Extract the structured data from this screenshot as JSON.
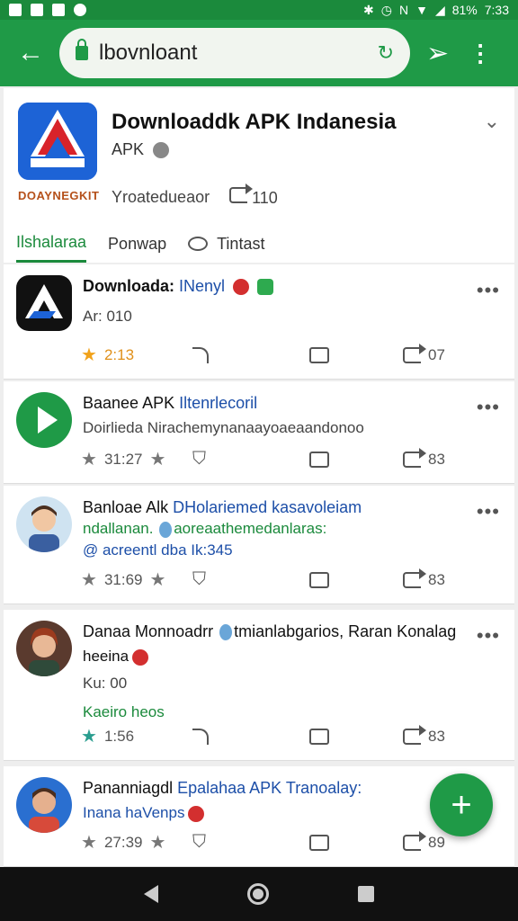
{
  "status": {
    "battery": "81%",
    "time": "7:33"
  },
  "browser": {
    "url": "lbovnloant",
    "send_icon": "send-icon",
    "more_icon": "more-vert-icon"
  },
  "header": {
    "title": "Downloaddk APK Indanesia",
    "subtitle": "APK",
    "brand_text": "DOAYNEGKIT",
    "meta_label": "Yroatedueaor",
    "meta_count": "110",
    "tabs": [
      {
        "label": "Ilshalaraa",
        "active": true
      },
      {
        "label": "Ponwap",
        "active": false
      },
      {
        "label": "Tintast",
        "active": false
      }
    ]
  },
  "posts": [
    {
      "title": "Downloada: ",
      "title_hl": "INenyl",
      "line1": "Ar: 010",
      "rating": "2:13",
      "share_count": "07"
    },
    {
      "title": "Baanee APK ",
      "title_hl": "Iltenrlecoril",
      "line1": "Doirlieda Nirachemynanaayoaeaandonoo",
      "rating": "31:27",
      "share_count": "83"
    },
    {
      "title": "Banloae Alk ",
      "title_hl": "DHolariemed kasavoleiam",
      "line1": "ndallanan. ",
      "line1_rest": "aoreaathemedanlaras:",
      "line2": "@ acreentl dba Ik:345",
      "rating": "31:69",
      "share_count": "83"
    },
    {
      "title": "Danaa Monnoadrr ",
      "title_hl": "tmianlabgarios, Raran Konalag",
      "line1": "heeina",
      "line2": "Ku: 00",
      "line3": "Kaeiro heos",
      "rating": "1:56",
      "share_count": "83"
    },
    {
      "title": "Pananniagdl ",
      "title_hl": "Epalahaa APK Tranoalay:",
      "line1": "Inana haVenps",
      "rating": "27:39",
      "share_count": "89"
    }
  ],
  "fab": {
    "label": "+"
  }
}
